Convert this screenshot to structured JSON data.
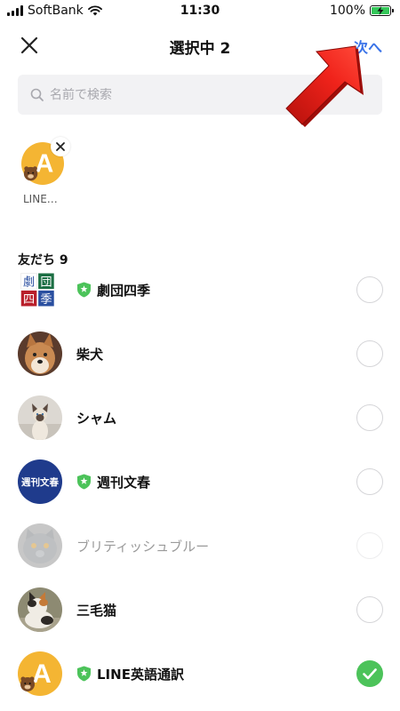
{
  "status_bar": {
    "carrier": "SoftBank",
    "time": "11:30",
    "battery": "100%",
    "battery_level": 1.0
  },
  "header": {
    "title": "選択中 2",
    "next_label": "次へ",
    "close_icon": "close-icon"
  },
  "search": {
    "placeholder": "名前で検索"
  },
  "selected_chip": {
    "label": "LINE…",
    "avatar_letter": "A"
  },
  "friends_section": {
    "title": "友だち 9",
    "items": [
      {
        "name": "劇団四季",
        "verified": true,
        "checked": false,
        "dimmed": false,
        "avatar": "shiki-logo"
      },
      {
        "name": "柴犬",
        "verified": false,
        "checked": false,
        "dimmed": false,
        "avatar": "shiba-photo"
      },
      {
        "name": "シャム",
        "verified": false,
        "checked": false,
        "dimmed": false,
        "avatar": "siamese-cat-photo"
      },
      {
        "name": "週刊文春",
        "verified": true,
        "checked": false,
        "dimmed": false,
        "avatar": "bunshun-logo"
      },
      {
        "name": "ブリティッシュブルー",
        "verified": false,
        "checked": false,
        "dimmed": true,
        "avatar": "british-blue-photo"
      },
      {
        "name": "三毛猫",
        "verified": false,
        "checked": false,
        "dimmed": false,
        "avatar": "calico-cat-photo"
      },
      {
        "name": "LINE英語通訳",
        "verified": true,
        "checked": true,
        "dimmed": false,
        "avatar": "line-english-logo"
      }
    ]
  },
  "logos": {
    "shiki": [
      "劇",
      "団",
      "四",
      "季"
    ],
    "bunshun": "週刊文春",
    "line_letter": "A"
  },
  "colors": {
    "accent_blue": "#3a73e8",
    "check_green": "#4cc35a",
    "verified_green": "#4cc35a",
    "search_bg": "#f2f2f4",
    "arrow_red": "#e8201a",
    "line_avatar_bg": "#f4b533",
    "bunshun_bg": "#1f3b8c"
  }
}
